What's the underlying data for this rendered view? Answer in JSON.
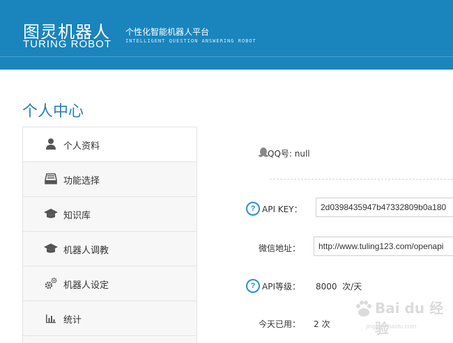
{
  "header": {
    "logo_cn": "图灵机器人",
    "logo_en": "TURING ROBOT",
    "tagline": "个性化智能机器人平台",
    "tagline_en": "INTELLIGENT QUESTION ANSWERING ROBOT",
    "background": "#1a84bd"
  },
  "page": {
    "title": "个人中心"
  },
  "sidebar": {
    "items": [
      {
        "label": "个人资料",
        "icon": "user-icon",
        "active": true
      },
      {
        "label": "功能选择",
        "icon": "drawer-icon"
      },
      {
        "label": "知识库",
        "icon": "graduation-cap-icon"
      },
      {
        "label": "机器人调教",
        "icon": "graduation-cap-icon"
      },
      {
        "label": "机器人设定",
        "icon": "gears-icon"
      },
      {
        "label": "统计",
        "icon": "bar-chart-icon"
      }
    ]
  },
  "profile": {
    "qq_label": "QQ号:",
    "qq_value": "null",
    "api_key_label": "API KEY：",
    "api_key_value": "2d0398435947b47332809b0a180",
    "wechat_label": "微信地址：",
    "wechat_value": "http://www.tuling123.com/openapi",
    "api_level_label": "API等级：",
    "api_level_value": "8000  次/天",
    "today_used_label": "今天已用：",
    "today_used_value": "2 次"
  },
  "watermark": {
    "text": "Bai du 经验",
    "url": "jingyan.baidu.com"
  }
}
